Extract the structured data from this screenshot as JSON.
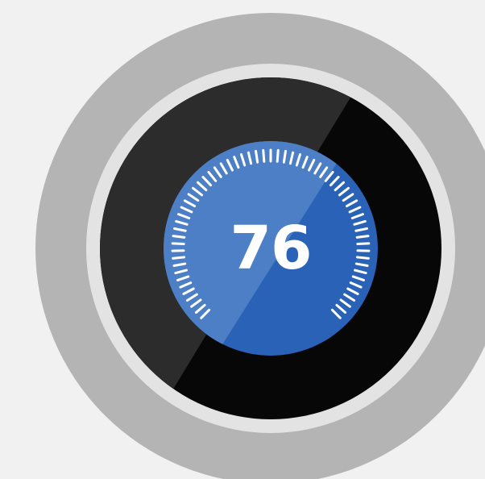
{
  "thermostat": {
    "target_temperature": "76",
    "icon": "thermostat-dial-icon",
    "colors": {
      "background": "#f1f1f1",
      "outer_ring": "#b4b4b4",
      "bezel": "#e3e3e3",
      "face_dark": "#2c2c2c",
      "face_black": "#070707",
      "dial_blue": "#2962b6",
      "dial_highlight": "#4d7fc6",
      "tick_color": "#ffffff"
    }
  }
}
